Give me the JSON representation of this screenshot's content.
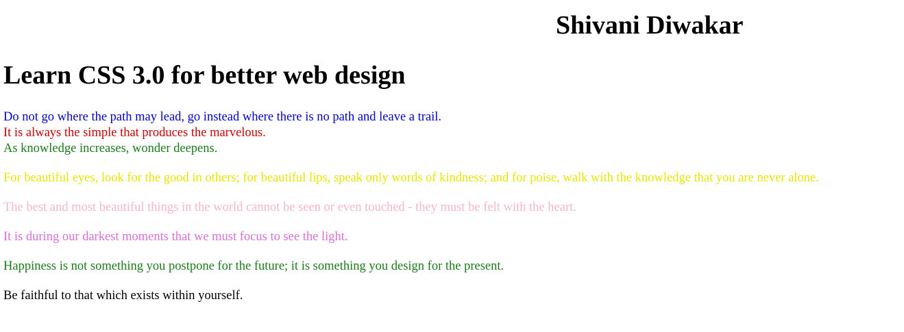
{
  "header": {
    "author": "Shivani Diwakar",
    "title": "Learn CSS 3.0 for better web design"
  },
  "quotes_block": [
    {
      "text": "Do not go where the path may lead, go instead where there is no path and leave a trail.",
      "color": "#0000cc"
    },
    {
      "text": "It is always the simple that produces the marvelous.",
      "color": "#cc0000"
    },
    {
      "text": "As knowledge increases, wonder deepens.",
      "color": "#1a7a1a"
    }
  ],
  "quotes": [
    {
      "text": "For beautiful eyes, look for the good in others; for beautiful lips, speak only words of kindness; and for poise, walk with the knowledge that you are never alone.",
      "color": "#e6e600"
    },
    {
      "text": "The best and most beautiful things in the world cannot be seen or even touched - they must be felt with the heart.",
      "color": "#f4b8c4"
    },
    {
      "text": "It is during our darkest moments that we must focus to see the light.",
      "color": "#d86fd8"
    },
    {
      "text": "Happiness is not something you postpone for the future; it is something you design for the present.",
      "color": "#1a7a1a"
    },
    {
      "text": "Be faithful to that which exists within yourself.",
      "color": "#000000"
    }
  ]
}
